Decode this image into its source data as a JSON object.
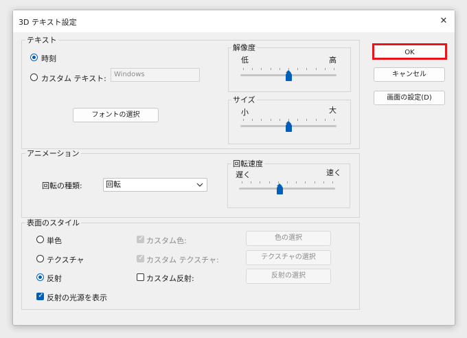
{
  "window": {
    "title": "3D テキスト設定",
    "close_glyph": "✕"
  },
  "text_group": {
    "label": "テキスト",
    "time_label": "時刻",
    "custom_label": "カスタム テキスト:",
    "custom_placeholder": "Windows",
    "font_button": "フォントの選択",
    "resolution": {
      "label": "解像度",
      "low": "低",
      "high": "高",
      "value": 0.5
    },
    "size": {
      "label": "サイズ",
      "low": "小",
      "high": "大",
      "value": 0.5
    }
  },
  "animation_group": {
    "label": "アニメーション",
    "rotation_type_label": "回転の種類:",
    "rotation_type_value": "回転",
    "speed": {
      "label": "回転速度",
      "low": "遅く",
      "high": "速く",
      "value": 0.42
    }
  },
  "surface_group": {
    "label": "表面のスタイル",
    "solid_label": "単色",
    "texture_label": "テクスチャ",
    "reflection_label": "反射",
    "custom_color_label": "カスタム色:",
    "custom_texture_label": "カスタム テクスチャ:",
    "custom_reflection_label": "カスタム反射:",
    "color_button": "色の選択",
    "texture_button": "テクスチャの選択",
    "reflection_button": "反射の選択",
    "show_light_label": "反射の光源を表示"
  },
  "buttons": {
    "ok": "OK",
    "cancel": "キャンセル",
    "display_settings": "画面の設定(D)"
  },
  "colors": {
    "accent": "#005fb8",
    "highlight": "#e8141c"
  }
}
